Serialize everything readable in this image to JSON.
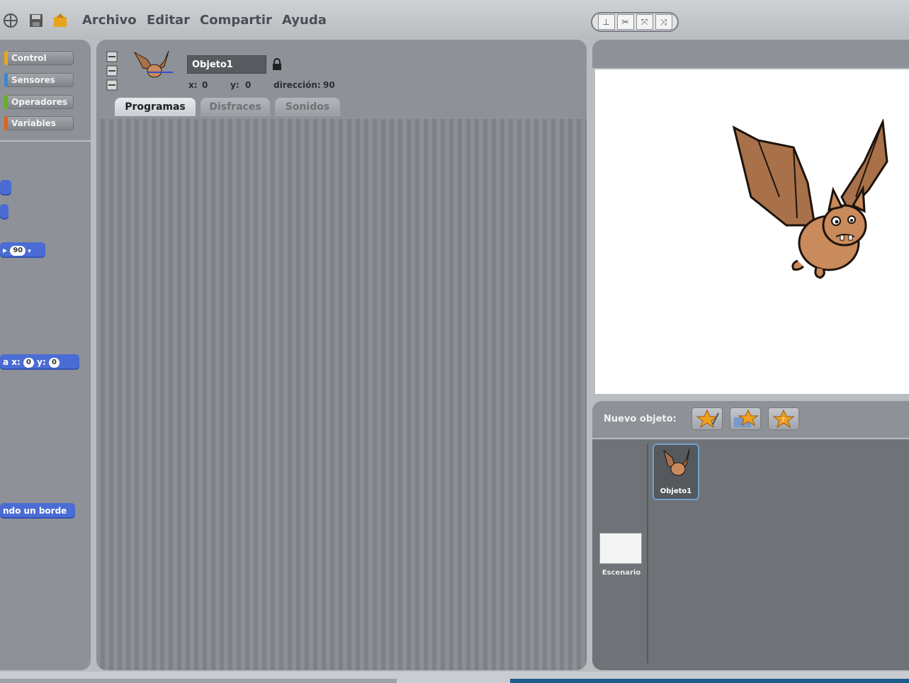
{
  "menu": {
    "items": [
      "Archivo",
      "Editar",
      "Compartir",
      "Ayuda"
    ]
  },
  "palette": {
    "categories": [
      {
        "label": "Control",
        "color": "#e6a821"
      },
      {
        "label": "Sensores",
        "color": "#3c86d6"
      },
      {
        "label": "Operadores",
        "color": "#5cb712"
      },
      {
        "label": "Variables",
        "color": "#e3611a"
      }
    ],
    "blocks": {
      "dropdown_value": "90",
      "goto_x_label": "a x:",
      "goto_x_value": "0",
      "goto_y_label": "y:",
      "goto_y_value": "0",
      "bounce_label": "ndo un borde"
    }
  },
  "sprite": {
    "name": "Objeto1",
    "x_label": "x:",
    "x_value": "0",
    "y_label": "y:",
    "y_value": "0",
    "direction_label": "dirección:",
    "direction_value": "90"
  },
  "tabs": [
    {
      "label": "Programas",
      "active": true
    },
    {
      "label": "Disfraces",
      "active": false
    },
    {
      "label": "Sonidos",
      "active": false
    }
  ],
  "sprite_list": {
    "new_sprite_label": "Nuevo objeto:",
    "sprites": [
      {
        "name": "Objeto1"
      }
    ],
    "stage_label": "Escenario"
  },
  "colors": {
    "accent": "#1e5e8c",
    "selected_border": "#6fa1d0",
    "block_blue": "#4a6cd4"
  }
}
